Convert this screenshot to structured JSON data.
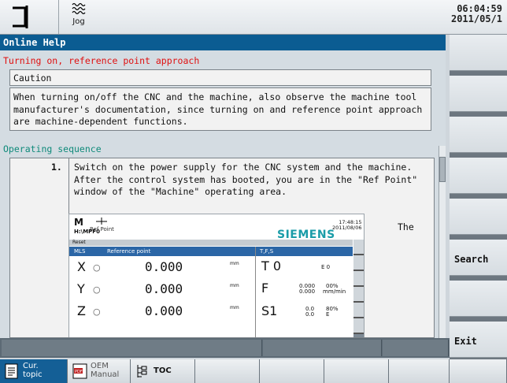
{
  "topbar": {
    "mode": "Jog",
    "time": "06:04:59",
    "date": "2011/05/1"
  },
  "panel": {
    "title": "Online Help",
    "heading": "Turning on, reference point approach",
    "caution_label": "Caution",
    "caution_text": "When turning on/off the CNC and the machine, also observe the machine tool manufacturer's documentation, since turning on and reference point approach are machine-dependent functions.",
    "section_heading": "Operating sequence",
    "step_number": "1.",
    "step_text": "Switch on the power supply for the CNC system and the machine. After the control system has booted, you are in the \"Ref Point\" window of the \"Machine\" operating area.",
    "after_image_text": "The"
  },
  "embedded_screen": {
    "mode_letter": "M",
    "mode_label": "Ref Point",
    "time": "17:48:15",
    "date": "2011/08/06",
    "path": "H:\\MPF0",
    "brand": "SIEMENS",
    "reset_label": "Reset",
    "table_col1": "MLS",
    "table_col2": "Reference point",
    "table_col3": "T,F,S",
    "axes": [
      {
        "name": "X",
        "value": "0.000",
        "unit": "mm"
      },
      {
        "name": "Y",
        "value": "0.000",
        "unit": "mm"
      },
      {
        "name": "Z",
        "value": "0.000",
        "unit": "mm"
      }
    ],
    "tool": "T 0",
    "tool_extra": "E  0",
    "feed_label": "F",
    "feed_val1": "0.000",
    "feed_val2": "0.000",
    "feed_pct": "00%",
    "feed_unit": "mm/min",
    "spindle": "S1",
    "spindle_val": "0.0",
    "spindle_val2": "0.0",
    "spindle_pct": "80%",
    "spindle_unit": "E"
  },
  "softkeys": [
    "",
    "",
    "",
    "",
    "",
    "Search",
    "",
    "Exit"
  ],
  "bottom_keys": [
    {
      "icon": "document-icon",
      "label": "Cur.\ntopic",
      "active": true
    },
    {
      "icon": "pdf-icon",
      "label": "OEM\nManual",
      "active": false
    },
    {
      "icon": "toc-icon",
      "label": "TOC",
      "active": false
    }
  ],
  "colors": {
    "title_bg": "#0b5c92",
    "heading": "#e01010",
    "section": "#0f8a7a",
    "brand": "#1a9ca8"
  }
}
